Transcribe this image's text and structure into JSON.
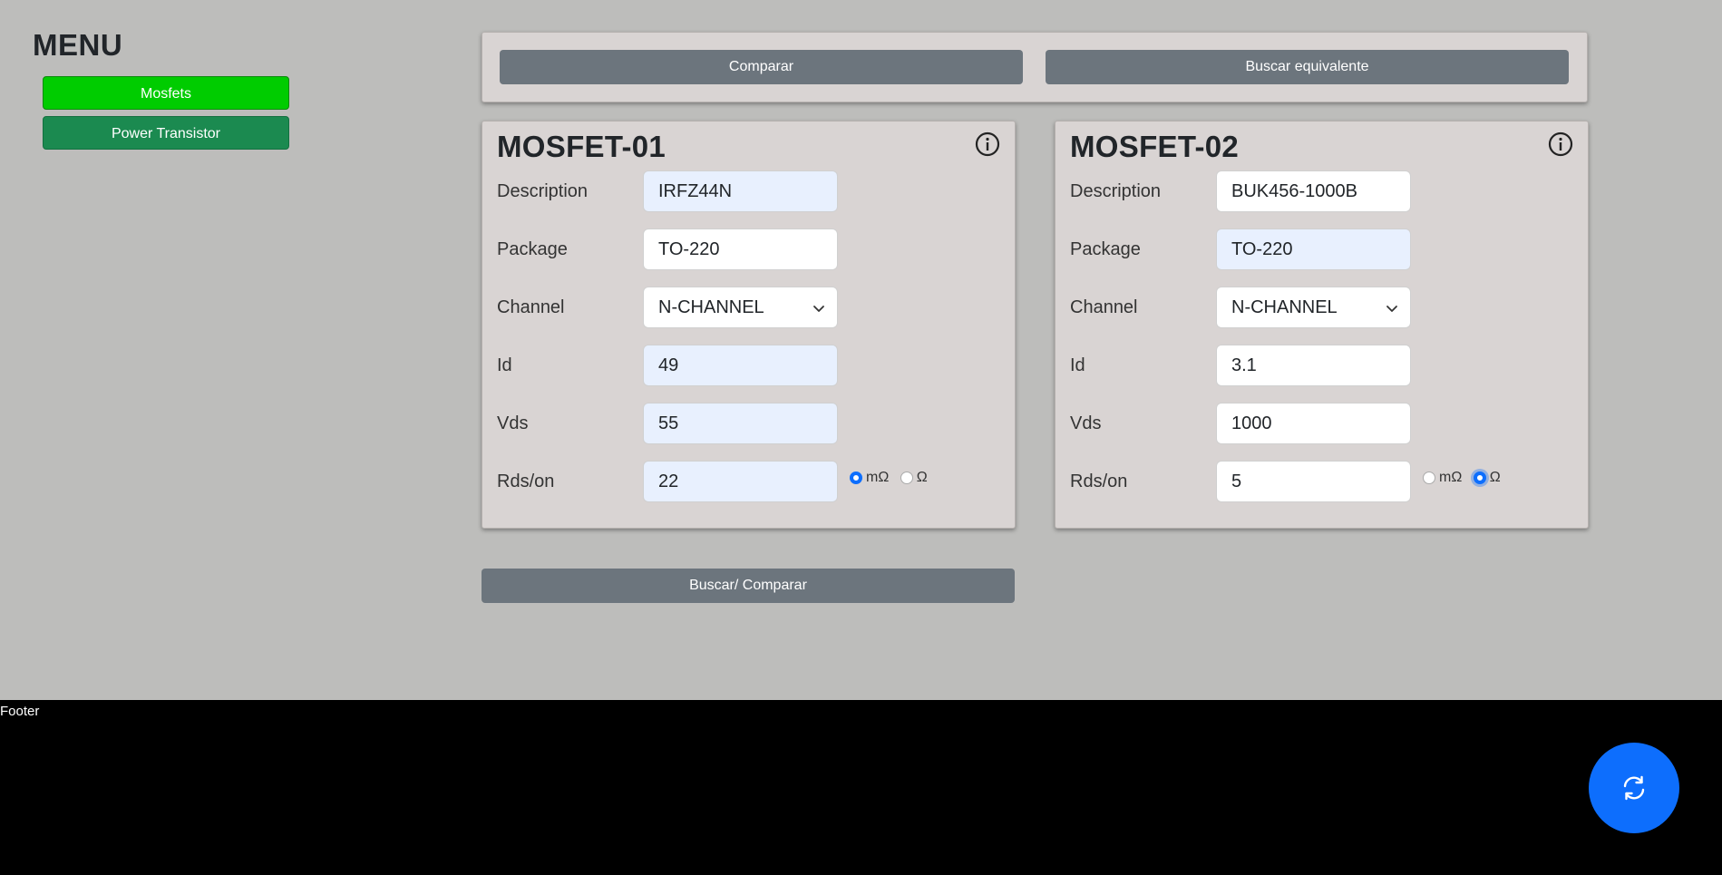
{
  "sidebar": {
    "title": "MENU",
    "items": [
      {
        "label": "Mosfets",
        "active": true
      },
      {
        "label": "Power Transistor",
        "active": false
      }
    ]
  },
  "toolbar": {
    "compare_label": "Comparar",
    "equivalent_label": "Buscar equivalente"
  },
  "mosfets": [
    {
      "title": "MOSFET-01",
      "fields": {
        "description": {
          "label": "Description",
          "value": "IRFZ44N"
        },
        "package": {
          "label": "Package",
          "value": "TO-220"
        },
        "channel": {
          "label": "Channel",
          "value": "N-CHANNEL"
        },
        "id": {
          "label": "Id",
          "value": "49"
        },
        "vds": {
          "label": "Vds",
          "value": "55"
        },
        "rds": {
          "label": "Rds/on",
          "value": "22"
        }
      },
      "units": {
        "milli": "mΩ",
        "ohm": "Ω",
        "selected": "mΩ"
      }
    },
    {
      "title": "MOSFET-02",
      "fields": {
        "description": {
          "label": "Description",
          "value": "BUK456-1000B"
        },
        "package": {
          "label": "Package",
          "value": "TO-220"
        },
        "channel": {
          "label": "Channel",
          "value": "N-CHANNEL"
        },
        "id": {
          "label": "Id",
          "value": "3.1"
        },
        "vds": {
          "label": "Vds",
          "value": "1000"
        },
        "rds": {
          "label": "Rds/on",
          "value": "5"
        }
      },
      "units": {
        "milli": "mΩ",
        "ohm": "Ω",
        "selected": "Ω"
      }
    }
  ],
  "search_compare_label": "Buscar/ Comparar",
  "footer": {
    "text": "Footer"
  },
  "colors": {
    "background": "#bdbdbb",
    "card": "#d9d4d3",
    "button_gray": "#6c757d",
    "active_green": "#00cc00",
    "nav_green": "#1b8a50",
    "accent_blue": "#0d6efd",
    "highlight_field": "#e8f0fe"
  },
  "icons": {
    "info": "info-circle-icon",
    "refresh": "refresh-icon",
    "chevron": "chevron-down-icon"
  }
}
